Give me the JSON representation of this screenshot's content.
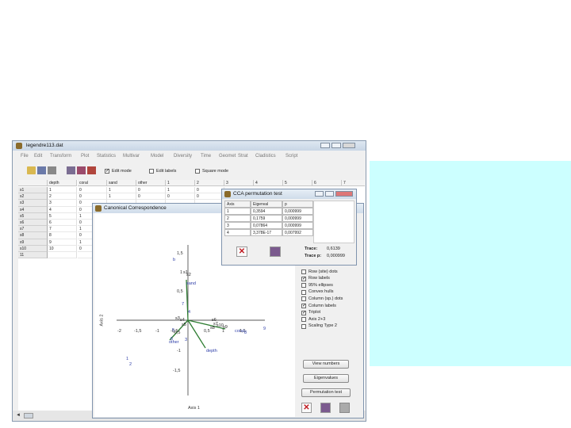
{
  "main_window": {
    "title": "legendre113.dat",
    "menu": [
      "File",
      "Edit",
      "Transform",
      "Plot",
      "Statistics",
      "Multivar",
      "Model",
      "Diversity",
      "Time",
      "Geomet",
      "Strat",
      "Cladistics",
      "Script"
    ],
    "toolbar": {
      "edit_mode": "Edit mode",
      "edit_labels": "Edit labels",
      "square_mode": "Square mode"
    },
    "columns": [
      "depth",
      "coral",
      "sand",
      "other",
      "1",
      "2",
      "3",
      "4",
      "5",
      "6",
      "7"
    ],
    "rows": [
      {
        "label": "s1",
        "values": [
          "1",
          "0",
          "1",
          "0",
          "1",
          "0"
        ]
      },
      {
        "label": "s2",
        "values": [
          "2",
          "0",
          "1",
          "0",
          "0",
          "0"
        ]
      },
      {
        "label": "s3",
        "values": [
          "3",
          "0",
          "",
          "",
          "",
          ""
        ]
      },
      {
        "label": "s4",
        "values": [
          "4",
          "0",
          "",
          "",
          "",
          ""
        ]
      },
      {
        "label": "s5",
        "values": [
          "5",
          "1",
          "",
          "",
          "",
          ""
        ]
      },
      {
        "label": "s6",
        "values": [
          "6",
          "0",
          "",
          "",
          "",
          ""
        ]
      },
      {
        "label": "s7",
        "values": [
          "7",
          "1",
          "",
          "",
          "",
          ""
        ]
      },
      {
        "label": "s8",
        "values": [
          "8",
          "0",
          "",
          "",
          "",
          ""
        ]
      },
      {
        "label": "s9",
        "values": [
          "9",
          "1",
          "",
          "",
          "",
          ""
        ]
      },
      {
        "label": "s10",
        "values": [
          "10",
          "0",
          "",
          "",
          "",
          ""
        ]
      },
      {
        "label": "11",
        "values": [
          "",
          "",
          "",
          "",
          "",
          ""
        ]
      }
    ]
  },
  "cca_window": {
    "title": "Canonical Correspondence",
    "x_axis_label": "Axis 1",
    "y_axis_label": "Axis 2",
    "x_ticks": [
      "-2",
      "-1,5",
      "-1",
      "-0,5",
      "0,5",
      "1",
      "1,5"
    ],
    "y_ticks": [
      "1,5",
      "1",
      "0,5",
      "-0,5",
      "-1",
      "-1,5"
    ],
    "checkboxes": [
      {
        "label": "Row (site) dots",
        "checked": false
      },
      {
        "label": "Row labels",
        "checked": true
      },
      {
        "label": "95% ellipses",
        "checked": false
      },
      {
        "label": "Convex hulls",
        "checked": false
      },
      {
        "label": "Column (sp.) dots",
        "checked": false
      },
      {
        "label": "Column labels",
        "checked": true
      },
      {
        "label": "Triplot",
        "checked": true
      },
      {
        "label": "Axis 2+3",
        "checked": false
      },
      {
        "label": "Scaling Type 2",
        "checked": false
      }
    ],
    "buttons": {
      "view_numbers": "View numbers",
      "eigenvalues": "Eigenvalues",
      "permutation_test": "Permutation test"
    },
    "env_labels": [
      "sand",
      "depth",
      "coral",
      "other"
    ],
    "species_labels": [
      "b",
      "7",
      "4",
      "5",
      "6",
      "1",
      "2",
      "3",
      "8",
      "9"
    ],
    "site_labels": [
      "s1",
      "s2",
      "s3",
      "s4",
      "s5",
      "s6",
      "s7",
      "s8",
      "s9",
      "s10"
    ]
  },
  "perm_window": {
    "title": "CCA permutation test",
    "headers": [
      "Axis",
      "Eigenval",
      "p"
    ],
    "rows": [
      [
        "1",
        "0,3594",
        "0,000999"
      ],
      [
        "2",
        "0,1759",
        "0,000999"
      ],
      [
        "3",
        "0,07864",
        "0,000999"
      ],
      [
        "4",
        "3,378E-17",
        "0,007992"
      ]
    ],
    "trace_label": "Trace:",
    "trace_value": "0,6139",
    "trace_p_label": "Trace p:",
    "trace_p_value": "0,000999"
  },
  "colors": {
    "side_panel": "#ccffff",
    "vector": "#2e7d32",
    "label_blue": "#2d3da8"
  }
}
